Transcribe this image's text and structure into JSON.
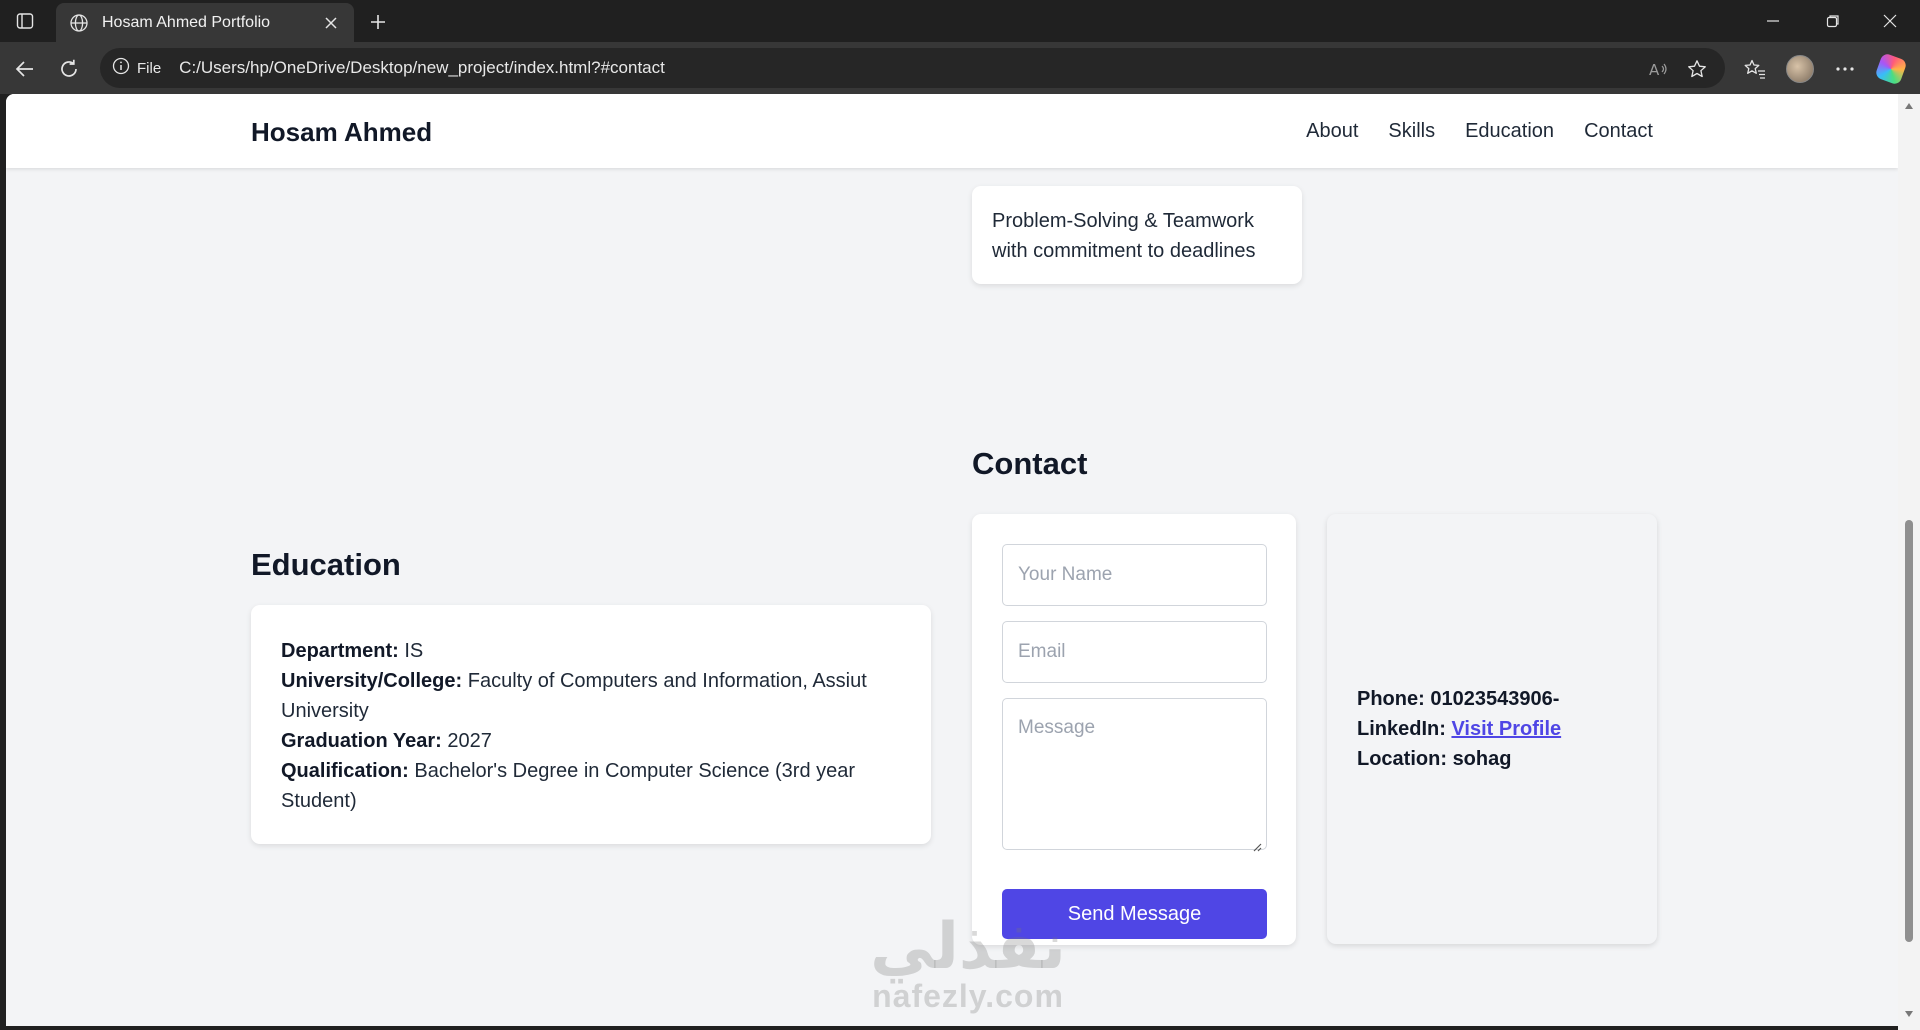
{
  "browser": {
    "tab_title": "Hosam Ahmed Portfolio",
    "address_chip": "File",
    "url": "C:/Users/hp/OneDrive/Desktop/new_project/index.html?#contact",
    "icons": [
      "tab-actions-icon",
      "globe-icon",
      "close-icon",
      "plus-icon",
      "minimize-icon",
      "restore-icon",
      "close-window-icon",
      "back-icon",
      "reload-icon",
      "info-icon",
      "read-aloud-icon",
      "star-icon",
      "favorites-icon",
      "profile-avatar",
      "more-icon",
      "copilot-icon"
    ]
  },
  "site": {
    "brand": "Hosam Ahmed",
    "nav": [
      "About",
      "Skills",
      "Education",
      "Contact"
    ]
  },
  "skills": {
    "card_text": "Problem-Solving & Teamwork with commitment to deadlines"
  },
  "education": {
    "heading": "Education",
    "department_label": "Department:",
    "department_value": "IS",
    "university_label": "University/College:",
    "university_value": "Faculty of Computers and Information, Assiut University",
    "graduation_label": "Graduation Year:",
    "graduation_value": "2027",
    "qualification_label": "Qualification:",
    "qualification_value": "Bachelor's Degree in Computer Science (3rd year Student)"
  },
  "contact": {
    "heading": "Contact",
    "name_placeholder": "Your Name",
    "email_placeholder": "Email",
    "message_placeholder": "Message",
    "send_label": "Send Message",
    "phone_label": "Phone:",
    "phone_value": "01023543906-",
    "linkedin_label": "LinkedIn:",
    "linkedin_link": "Visit Profile",
    "location_label": "Location:",
    "location_value": "sohag"
  },
  "watermark": {
    "arabic": "نفذلي",
    "latin": "nafezly.com"
  },
  "colors": {
    "accent": "#4f46e5",
    "page_bg": "#f3f4f6",
    "browser_bg": "#202020"
  }
}
